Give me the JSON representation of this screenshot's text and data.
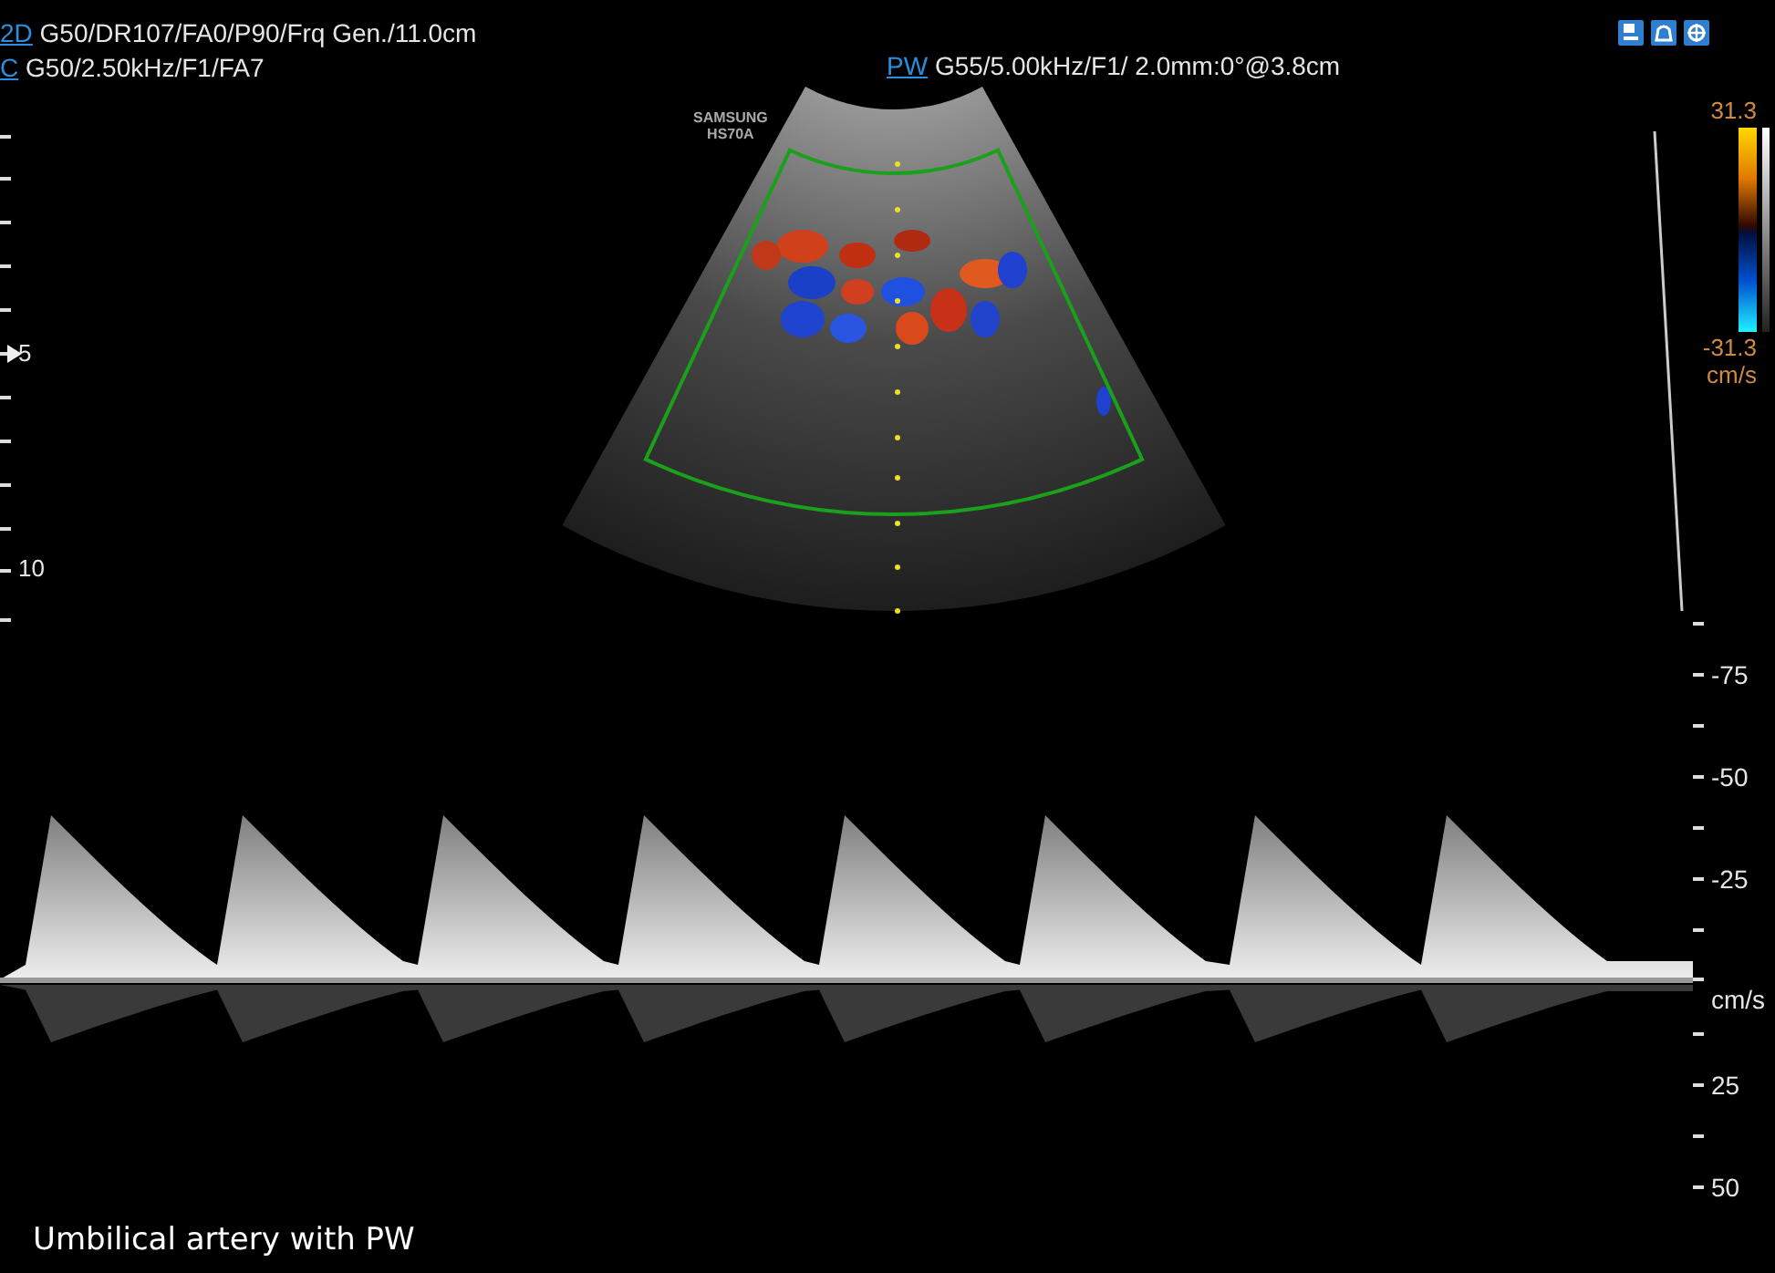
{
  "header": {
    "mode_lines": [
      {
        "mode": "2D",
        "params": "G50/DR107/FA0/P90/Frq Gen./11.0cm"
      },
      {
        "mode": "C",
        "params": "G50/2.50kHz/F1/FA7"
      }
    ],
    "pw_line": {
      "mode": "PW",
      "params": "G55/5.00kHz/F1/ 2.0mm:0°@3.8cm"
    }
  },
  "probe_label": [
    "SAMSUNG",
    "HS70A"
  ],
  "depth_scale": {
    "labels": [
      "5",
      "10"
    ]
  },
  "color_bar": {
    "max": "31.3",
    "min": "-31.3",
    "unit": "cm/s"
  },
  "velocity_scale": {
    "labels": [
      "-75",
      "-50",
      "-25",
      "cm/s",
      "25",
      "50"
    ]
  },
  "caption": "Umbilical artery with PW"
}
